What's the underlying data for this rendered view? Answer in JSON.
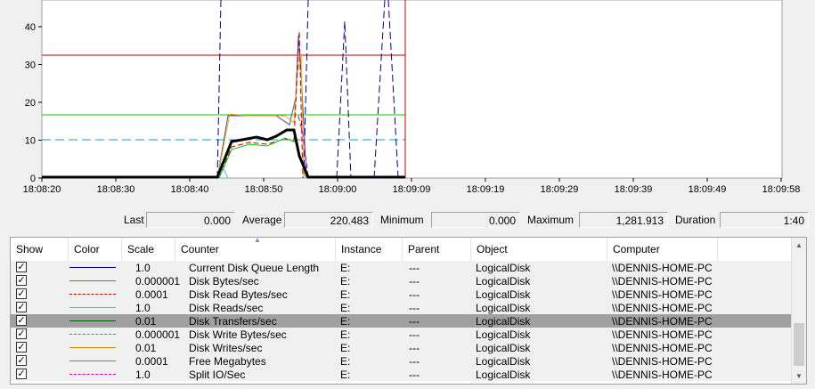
{
  "graph": {
    "y_ticks": [
      "40",
      "30",
      "20",
      "10",
      "0"
    ],
    "x_ticks": [
      "18:08:20",
      "18:08:30",
      "18:08:40",
      "18:08:50",
      "18:09:00",
      "18:09:09",
      "18:09:19",
      "18:09:29",
      "18:09:39",
      "18:09:49",
      "18:09:58"
    ],
    "colors": {
      "red": "#b00000",
      "green": "#00cc00",
      "cyan": "#00a0e0",
      "blue": "#00008b",
      "black": "#000000",
      "orange": "#ffa500",
      "magenta": "#cc00cc"
    }
  },
  "stats": {
    "last_label": "Last",
    "last_value": "0.000",
    "average_label": "Average",
    "average_value": "220.483",
    "minimum_label": "Minimum",
    "minimum_value": "0.000",
    "maximum_label": "Maximum",
    "maximum_value": "1,281.913",
    "duration_label": "Duration",
    "duration_value": "1:40"
  },
  "legend": {
    "columns": [
      "Show",
      "Color",
      "Scale",
      "Counter",
      "Instance",
      "Parent",
      "Object",
      "Computer"
    ],
    "rows": [
      {
        "scale": "1.0",
        "counter": "Current Disk Queue Length",
        "instance": "E:",
        "parent": "---",
        "object": "LogicalDisk",
        "computer": "\\\\DENNIS-HOME-PC",
        "color": "#00008b",
        "dash": "solid",
        "check": "✓"
      },
      {
        "scale": "0.000001",
        "counter": "Disk Bytes/sec",
        "instance": "E:",
        "parent": "---",
        "object": "LogicalDisk",
        "computer": "\\\\DENNIS-HOME-PC",
        "color": "#808000",
        "dash": "solid",
        "check": "✓"
      },
      {
        "scale": "0.0001",
        "counter": "Disk Read Bytes/sec",
        "instance": "E:",
        "parent": "---",
        "object": "LogicalDisk",
        "computer": "\\\\DENNIS-HOME-PC",
        "color": "#c00000",
        "dash": "dashed",
        "check": "✓"
      },
      {
        "scale": "1.0",
        "counter": "Disk Reads/sec",
        "instance": "E:",
        "parent": "---",
        "object": "LogicalDisk",
        "computer": "\\\\DENNIS-HOME-PC",
        "color": "#40c0e0",
        "dash": "solid",
        "check": "✓"
      },
      {
        "scale": "0.01",
        "counter": "Disk Transfers/sec",
        "instance": "E:",
        "parent": "---",
        "object": "LogicalDisk",
        "computer": "\\\\DENNIS-HOME-PC",
        "color": "#006000",
        "dash": "solid",
        "check": "✓",
        "selected": true
      },
      {
        "scale": "0.000001",
        "counter": "Disk Write Bytes/sec",
        "instance": "E:",
        "parent": "---",
        "object": "LogicalDisk",
        "computer": "\\\\DENNIS-HOME-PC",
        "color": "#00cc00",
        "dash": "dashed",
        "check": "✓"
      },
      {
        "scale": "0.01",
        "counter": "Disk Writes/sec",
        "instance": "E:",
        "parent": "---",
        "object": "LogicalDisk",
        "computer": "\\\\DENNIS-HOME-PC",
        "color": "#e08000",
        "dash": "solid",
        "check": "✓"
      },
      {
        "scale": "0.0001",
        "counter": "Free Megabytes",
        "instance": "E:",
        "parent": "---",
        "object": "LogicalDisk",
        "computer": "\\\\DENNIS-HOME-PC",
        "color": "#00d000",
        "dash": "solid",
        "check": "✓"
      },
      {
        "scale": "1.0",
        "counter": "Split IO/Sec",
        "instance": "E:",
        "parent": "---",
        "object": "LogicalDisk",
        "computer": "\\\\DENNIS-HOME-PC",
        "color": "#cc00cc",
        "dash": "dashed",
        "check": "✓"
      }
    ]
  },
  "icons": {
    "sort": "sort-up-icon",
    "scroll_up": "scroll-up-arrow-icon",
    "scroll_down": "scroll-down-arrow-icon"
  }
}
